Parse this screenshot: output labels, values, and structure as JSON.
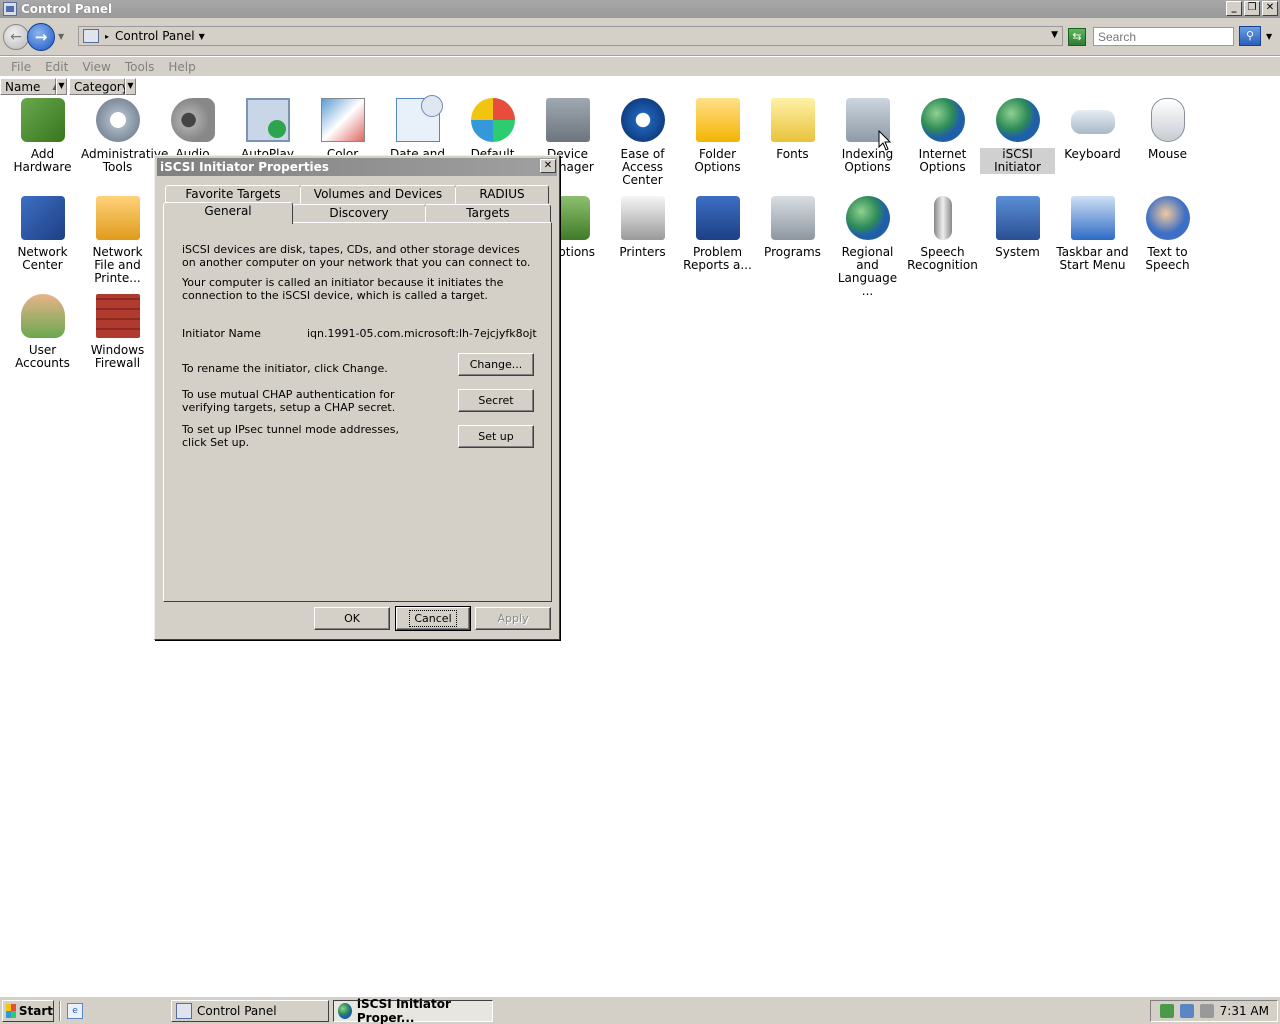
{
  "window": {
    "title": "Control Panel",
    "caption_min": "_",
    "caption_max": "❐",
    "caption_close": "✕"
  },
  "nav": {
    "back_glyph": "←",
    "forward_glyph": "→",
    "address_text": "Control Panel",
    "search_placeholder": "Search",
    "refresh_glyph": "⇆",
    "search_glyph": "⚲"
  },
  "menu": [
    "File",
    "Edit",
    "View",
    "Tools",
    "Help"
  ],
  "columns": {
    "name": "Name",
    "category": "Category"
  },
  "items": [
    {
      "label": "Add Hardware",
      "icon": "add-hardware-icon"
    },
    {
      "label": "Administrative Tools",
      "icon": "administrative-tools-icon"
    },
    {
      "label": "Audio Devices",
      "icon": "audio-devices-icon"
    },
    {
      "label": "AutoPlay",
      "icon": "autoplay-icon"
    },
    {
      "label": "Color",
      "icon": "color-icon"
    },
    {
      "label": "Date and Time",
      "icon": "date-and-time-icon"
    },
    {
      "label": "Default",
      "icon": "default-programs-icon"
    },
    {
      "label": "Device Manager",
      "icon": "device-manager-icon"
    },
    {
      "label": "Ease of Access Center",
      "icon": "ease-of-access-icon"
    },
    {
      "label": "Folder Options",
      "icon": "folder-options-icon"
    },
    {
      "label": "Fonts",
      "icon": "fonts-icon"
    },
    {
      "label": "Indexing Options",
      "icon": "indexing-options-icon"
    },
    {
      "label": "Internet Options",
      "icon": "internet-options-icon"
    },
    {
      "label": "iSCSI Initiator",
      "icon": "iscsi-initiator-icon"
    },
    {
      "label": "Keyboard",
      "icon": "keyboard-icon"
    },
    {
      "label": "Mouse",
      "icon": "mouse-icon"
    },
    {
      "label": "Network Center",
      "icon": "network-center-icon"
    },
    {
      "label": "Network File and Printe...",
      "icon": "network-file-printer-icon"
    },
    {
      "label": "r Options",
      "icon": "power-options-icon"
    },
    {
      "label": "Printers",
      "icon": "printers-icon"
    },
    {
      "label": "Problem Reports a...",
      "icon": "problem-reports-icon"
    },
    {
      "label": "Programs",
      "icon": "programs-icon"
    },
    {
      "label": "Regional and Language ...",
      "icon": "regional-language-icon"
    },
    {
      "label": "Speech Recognition",
      "icon": "speech-recognition-icon"
    },
    {
      "label": "System",
      "icon": "system-icon"
    },
    {
      "label": "Taskbar and Start Menu",
      "icon": "taskbar-start-menu-icon"
    },
    {
      "label": "Text to Speech",
      "icon": "text-to-speech-icon"
    },
    {
      "label": "User Accounts",
      "icon": "user-accounts-icon"
    },
    {
      "label": "Windows Firewall",
      "icon": "windows-firewall-icon"
    }
  ],
  "dialog": {
    "title": "iSCSI Initiator Properties",
    "close_glyph": "✕",
    "tabs_back": [
      "Favorite Targets",
      "Volumes and Devices",
      "RADIUS"
    ],
    "tabs_front": [
      "General",
      "Discovery",
      "Targets"
    ],
    "active_tab": "General",
    "intro_1": "iSCSI devices are disk, tapes, CDs, and other storage devices on another computer on your network that you can connect to.",
    "intro_2": "Your computer is called an initiator because it initiates the connection to the iSCSI device, which is called a target.",
    "initiator_label": "Initiator Name",
    "initiator_value": "iqn.1991-05.com.microsoft:lh-7ejcjyfk8ojt",
    "rename_text": "To rename the initiator, click Change.",
    "change_button": "Change...",
    "chap_text": "To use mutual CHAP authentication for verifying targets, setup a CHAP secret.",
    "secret_button": "Secret",
    "ipsec_text": "To set up IPsec tunnel mode addresses, click Set up.",
    "setup_button": "Set up",
    "ok_button": "OK",
    "cancel_button": "Cancel",
    "apply_button": "Apply"
  },
  "taskbar": {
    "start_label": "Start",
    "tasks": [
      "Control Panel",
      "iSCSI Initiator Proper..."
    ],
    "active_task": "iSCSI Initiator Proper...",
    "clock": "7:31 AM"
  }
}
